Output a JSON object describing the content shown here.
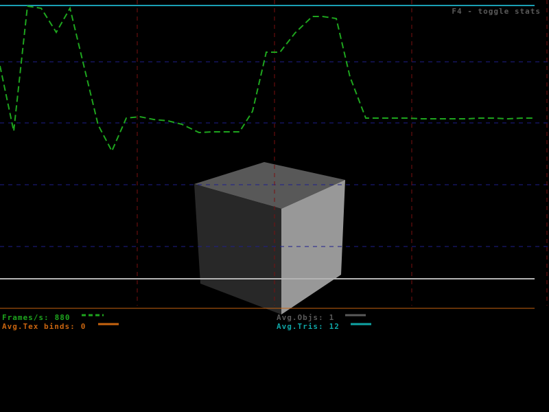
{
  "hint": {
    "text": "F4 - toggle stats",
    "color": "#5a5a5a"
  },
  "stats": {
    "fps": {
      "label": "Frames/s:",
      "value": "880",
      "color": "#1ea51e",
      "line_style": "dashed"
    },
    "tex_binds": {
      "label": "Avg.Tex binds:",
      "value": "0",
      "color": "#c8640f",
      "line_style": "solid"
    },
    "objs": {
      "label": "Avg.Objs:",
      "value": "1",
      "color": "#5a5a5a",
      "line_style": "solid"
    },
    "tris": {
      "label": "Avg.Tris:",
      "value": "12",
      "color": "#0fa5a5",
      "line_style": "solid"
    }
  },
  "grid": {
    "horizontal_color": "#1e1e8c",
    "vertical_color": "#7a1010"
  },
  "scene": {
    "object": "cube",
    "colors": {
      "top": "#585858",
      "left": "#282828",
      "right": "#989898"
    }
  },
  "colors": {
    "background": "#000000",
    "objs_line": "#b4b4b4",
    "tris_line": "#1aa0b4",
    "baseline": "#c8640f"
  }
}
